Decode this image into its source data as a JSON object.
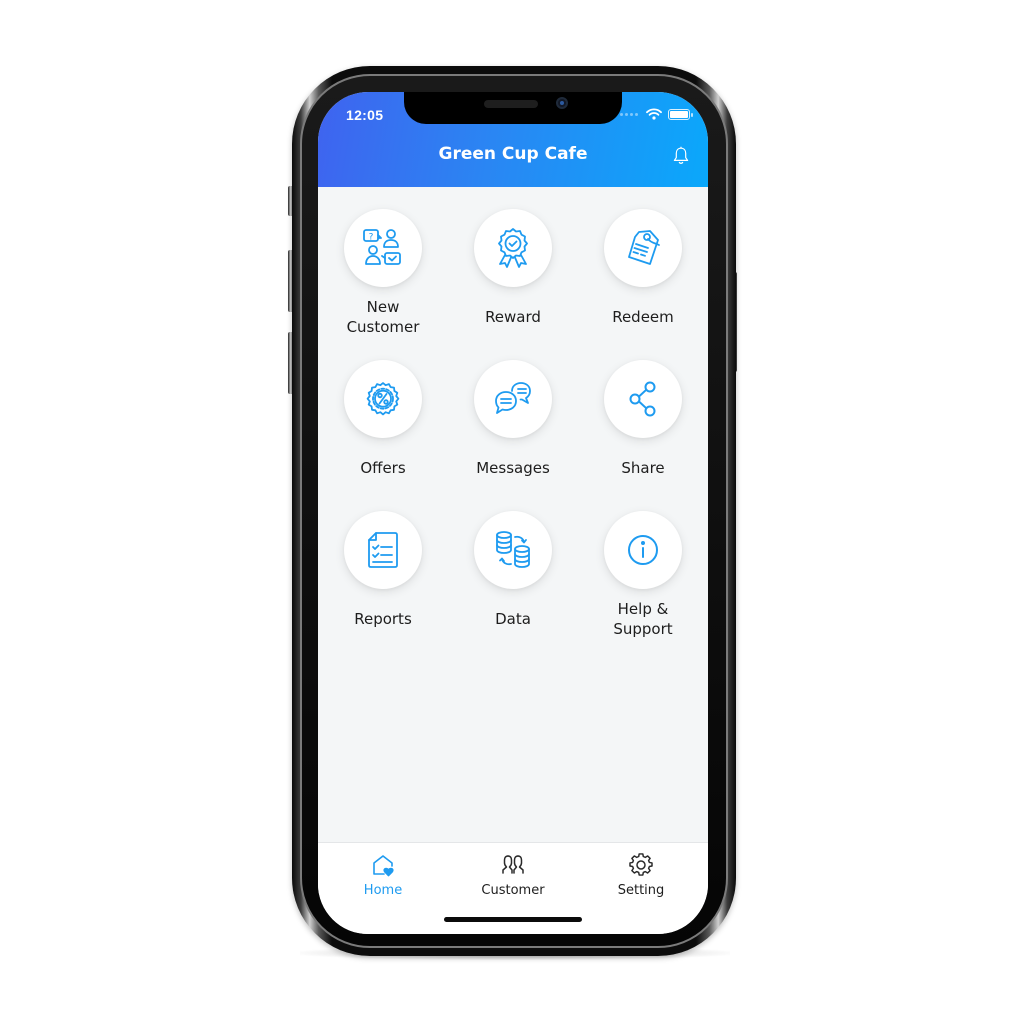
{
  "status_bar": {
    "time": "12:05",
    "icons": [
      "signal-dots-icon",
      "wifi-icon",
      "battery-icon"
    ]
  },
  "header": {
    "title": "Green Cup Cafe",
    "notification_icon": "bell-icon"
  },
  "colors": {
    "header_gradient_start": "#3f63ef",
    "header_gradient_end": "#0aa8fb",
    "icon_accent": "#1e9bf0",
    "background": "#f4f6f7",
    "text": "#1e1e1e"
  },
  "menu": {
    "items": [
      {
        "label": "New Customer",
        "icon": "new-customer-icon"
      },
      {
        "label": "Reward",
        "icon": "reward-badge-icon"
      },
      {
        "label": "Redeem",
        "icon": "redeem-tag-icon"
      },
      {
        "label": "Offers",
        "icon": "offers-percent-icon"
      },
      {
        "label": "Messages",
        "icon": "messages-chat-icon"
      },
      {
        "label": "Share",
        "icon": "share-icon"
      },
      {
        "label": "Reports",
        "icon": "reports-checklist-icon"
      },
      {
        "label": "Data",
        "icon": "data-database-icon"
      },
      {
        "label": "Help & Support",
        "icon": "info-icon"
      }
    ]
  },
  "tabbar": {
    "tabs": [
      {
        "label": "Home",
        "icon": "home-heart-icon",
        "active": true
      },
      {
        "label": "Customer",
        "icon": "customers-icon",
        "active": false
      },
      {
        "label": "Setting",
        "icon": "gear-icon",
        "active": false
      }
    ]
  }
}
